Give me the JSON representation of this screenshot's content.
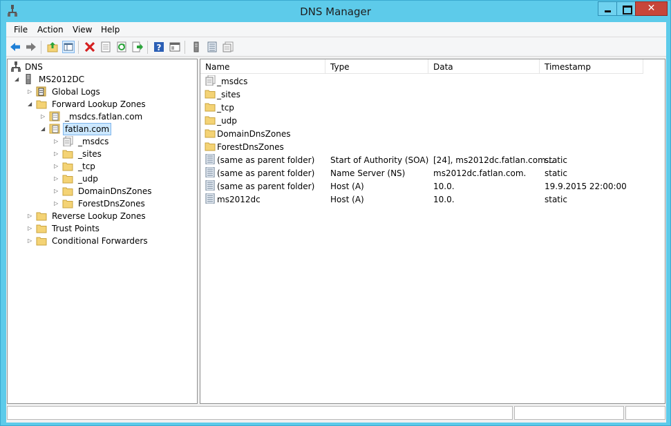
{
  "window": {
    "title": "DNS Manager",
    "close_glyph": "✕"
  },
  "menu": [
    "File",
    "Action",
    "View",
    "Help"
  ],
  "toolbar": {
    "icons": [
      "back-arrow-icon",
      "forward-arrow-icon",
      "up-folder-icon",
      "show-hide-tree-icon",
      "delete-icon",
      "properties-icon",
      "refresh-icon",
      "export-list-icon",
      "help-icon",
      "console-view-icon",
      "server-icon",
      "list-icon",
      "zone-icon"
    ]
  },
  "tree": [
    {
      "label": "DNS",
      "icon": "dns-root-icon",
      "expander": ""
    },
    {
      "label": "MS2012DC",
      "icon": "server-icon",
      "expander": "◢"
    },
    {
      "label": "Global Logs",
      "icon": "log-icon",
      "expander": "▷"
    },
    {
      "label": "Forward Lookup Zones",
      "icon": "folder-icon",
      "expander": "◢"
    },
    {
      "label": "_msdcs.fatlan.com",
      "icon": "zone-icon",
      "expander": "▷"
    },
    {
      "label": "fatlan.com",
      "icon": "zone-icon",
      "expander": "◢",
      "selected": true
    },
    {
      "label": "_msdcs",
      "icon": "zone-doc-icon",
      "expander": "▷"
    },
    {
      "label": "_sites",
      "icon": "folder-icon",
      "expander": "▷"
    },
    {
      "label": "_tcp",
      "icon": "folder-icon",
      "expander": "▷"
    },
    {
      "label": "_udp",
      "icon": "folder-icon",
      "expander": "▷"
    },
    {
      "label": "DomainDnsZones",
      "icon": "folder-icon",
      "expander": "▷"
    },
    {
      "label": "ForestDnsZones",
      "icon": "folder-icon",
      "expander": "▷"
    },
    {
      "label": "Reverse Lookup Zones",
      "icon": "folder-icon",
      "expander": "▷"
    },
    {
      "label": "Trust Points",
      "icon": "folder-icon",
      "expander": "▷"
    },
    {
      "label": "Conditional Forwarders",
      "icon": "folder-icon",
      "expander": "▷"
    }
  ],
  "list": {
    "columns": [
      "Name",
      "Type",
      "Data",
      "Timestamp"
    ],
    "rows": [
      {
        "name": "_msdcs",
        "type": "",
        "data": "",
        "timestamp": "",
        "icon": "zone-doc-icon"
      },
      {
        "name": "_sites",
        "type": "",
        "data": "",
        "timestamp": "",
        "icon": "folder-icon"
      },
      {
        "name": "_tcp",
        "type": "",
        "data": "",
        "timestamp": "",
        "icon": "folder-icon"
      },
      {
        "name": "_udp",
        "type": "",
        "data": "",
        "timestamp": "",
        "icon": "folder-icon"
      },
      {
        "name": "DomainDnsZones",
        "type": "",
        "data": "",
        "timestamp": "",
        "icon": "folder-icon"
      },
      {
        "name": "ForestDnsZones",
        "type": "",
        "data": "",
        "timestamp": "",
        "icon": "folder-icon"
      },
      {
        "name": "(same as parent folder)",
        "type": "Start of Authority (SOA)",
        "data": "[24], ms2012dc.fatlan.com...",
        "timestamp": "static",
        "icon": "record-icon"
      },
      {
        "name": "(same as parent folder)",
        "type": "Name Server (NS)",
        "data": "ms2012dc.fatlan.com.",
        "timestamp": "static",
        "icon": "record-icon"
      },
      {
        "name": "(same as parent folder)",
        "type": "Host (A)",
        "data": "10.0.",
        "timestamp": "19.9.2015 22:00:00",
        "icon": "record-icon"
      },
      {
        "name": "ms2012dc",
        "type": "Host (A)",
        "data": "10.0.",
        "timestamp": "static",
        "icon": "record-icon"
      }
    ]
  },
  "colors": {
    "titlebar": "#5dcbea",
    "close_button": "#c7463a",
    "selection": "#cce8ff",
    "folder": "#f4d375"
  }
}
